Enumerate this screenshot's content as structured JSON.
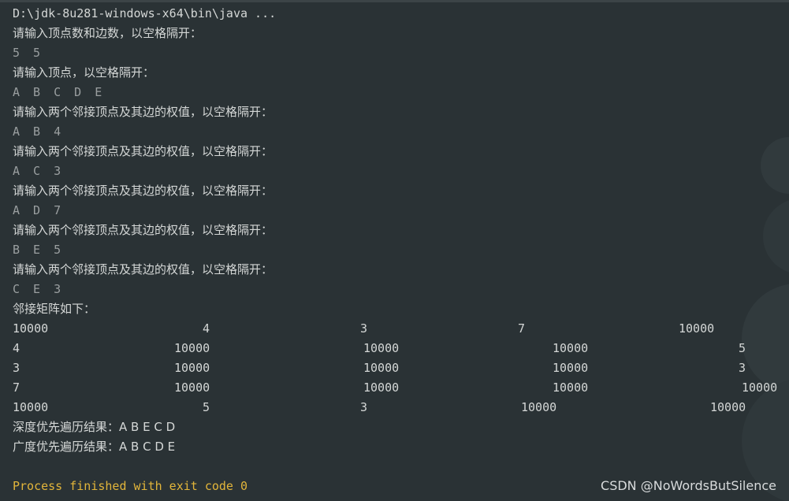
{
  "console": {
    "command": "D:\\jdk-8u281-windows-x64\\bin\\java ...",
    "prompt_counts": "请输入顶点数和边数，以空格隔开：",
    "input_counts": "5 5",
    "prompt_vertices": "请输入顶点，以空格隔开：",
    "input_vertices": "A B C D E",
    "edge_prompt": "请输入两个邻接顶点及其边的权值，以空格隔开：",
    "edges": [
      {
        "prompt": "请输入两个邻接顶点及其边的权值，以空格隔开：",
        "input": "A B 4"
      },
      {
        "prompt": "请输入两个邻接顶点及其边的权值，以空格隔开：",
        "input": "A C 3"
      },
      {
        "prompt": "请输入两个邻接顶点及其边的权值，以空格隔开：",
        "input": "A D 7"
      },
      {
        "prompt": "请输入两个邻接顶点及其边的权值，以空格隔开：",
        "input": "B E 5"
      },
      {
        "prompt": "请输入两个邻接顶点及其边的权值，以空格隔开：",
        "input": "C E 3"
      }
    ],
    "matrix_title": "邻接矩阵如下：",
    "matrix": [
      [
        "10000",
        "4",
        "3",
        "7",
        "10000"
      ],
      [
        "4",
        "10000",
        "10000",
        "10000",
        "5"
      ],
      [
        "3",
        "10000",
        "10000",
        "10000",
        "3"
      ],
      [
        "7",
        "10000",
        "10000",
        "10000",
        "10000"
      ],
      [
        "10000",
        "5",
        "3",
        "10000",
        "10000"
      ]
    ],
    "dfs_result": "深度优先遍历结果：A B E C D",
    "bfs_result": "广度优先遍历结果：A B C D E",
    "exit_message": "Process finished with exit code 0"
  },
  "watermark": "CSDN @NoWordsButSilence",
  "colors": {
    "background": "#2a3235",
    "text": "#d4d7d6",
    "user_input": "#9a9fa0",
    "exit_text": "#e2b53a"
  }
}
